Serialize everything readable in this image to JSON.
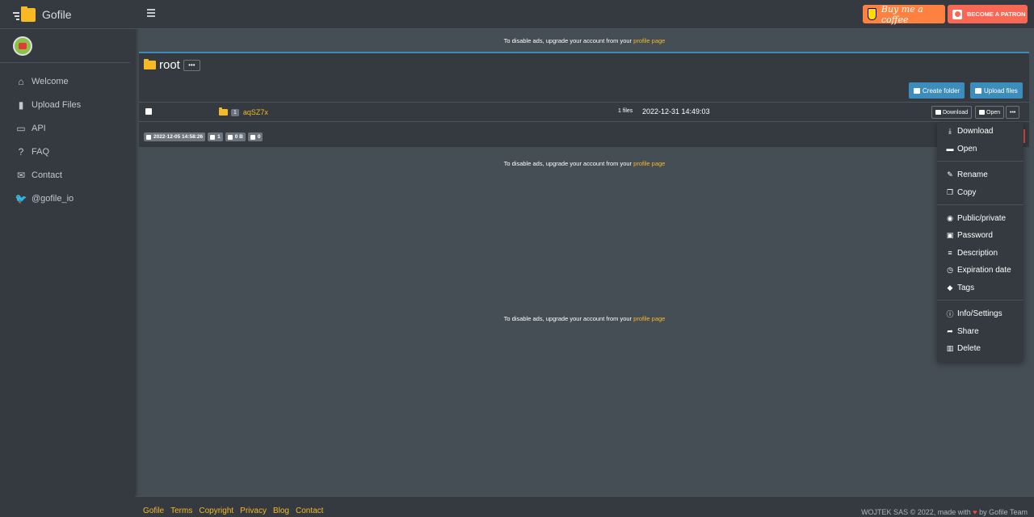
{
  "brand": {
    "name": "Gofile"
  },
  "sidebar": {
    "items": [
      {
        "label": "Welcome",
        "icon": "home-icon"
      },
      {
        "label": "Upload Files",
        "icon": "file-icon"
      },
      {
        "label": "API",
        "icon": "laptop-icon"
      },
      {
        "label": "FAQ",
        "icon": "question-icon"
      },
      {
        "label": "Contact",
        "icon": "envelope-icon"
      },
      {
        "label": "@gofile_io",
        "icon": "twitter-icon"
      }
    ]
  },
  "topbar": {
    "bmc_label": "Buy me a coffee",
    "patron_label": "BECOME A PATRON"
  },
  "ads": {
    "text": "To disable ads, upgrade your account from your",
    "link": "profile page"
  },
  "folder": {
    "title": "root",
    "menu_label": "•••",
    "create_folder_label": "Create folder",
    "upload_files_label": "Upload files",
    "created": "2022-12-05 14:58:26",
    "children_count": "1",
    "size": "0 B",
    "downloads": "0"
  },
  "rows": [
    {
      "count": "1",
      "name": "aqSZ7x",
      "files": "1 files",
      "date": "2022-12-31 14:49:03",
      "download_label": "Download",
      "open_label": "Open",
      "more_label": "•••"
    }
  ],
  "dropdown": {
    "items": [
      {
        "label": "Download",
        "icon": "download-icon"
      },
      {
        "label": "Open",
        "icon": "folder-open-icon"
      },
      {
        "label": "Rename",
        "icon": "edit-icon"
      },
      {
        "label": "Copy",
        "icon": "copy-icon"
      },
      {
        "label": "Public/private",
        "icon": "eye-icon"
      },
      {
        "label": "Password",
        "icon": "lock-icon"
      },
      {
        "label": "Description",
        "icon": "align-center-icon"
      },
      {
        "label": "Expiration date",
        "icon": "clock-icon"
      },
      {
        "label": "Tags",
        "icon": "tags-icon"
      },
      {
        "label": "Info/Settings",
        "icon": "info-icon"
      },
      {
        "label": "Share",
        "icon": "share-icon"
      },
      {
        "label": "Delete",
        "icon": "trash-icon"
      }
    ]
  },
  "footer": {
    "links": [
      "Gofile",
      "Terms",
      "Copyright",
      "Privacy",
      "Blog",
      "Contact"
    ],
    "copyright_prefix": "WOJTEK SAS © 2022, made with",
    "copyright_suffix": "by Gofile Team"
  },
  "colors": {
    "accent": "#f7b924",
    "primary": "#3c8dbc",
    "sidebar_bg": "#343a40",
    "content_bg": "#454d55"
  }
}
